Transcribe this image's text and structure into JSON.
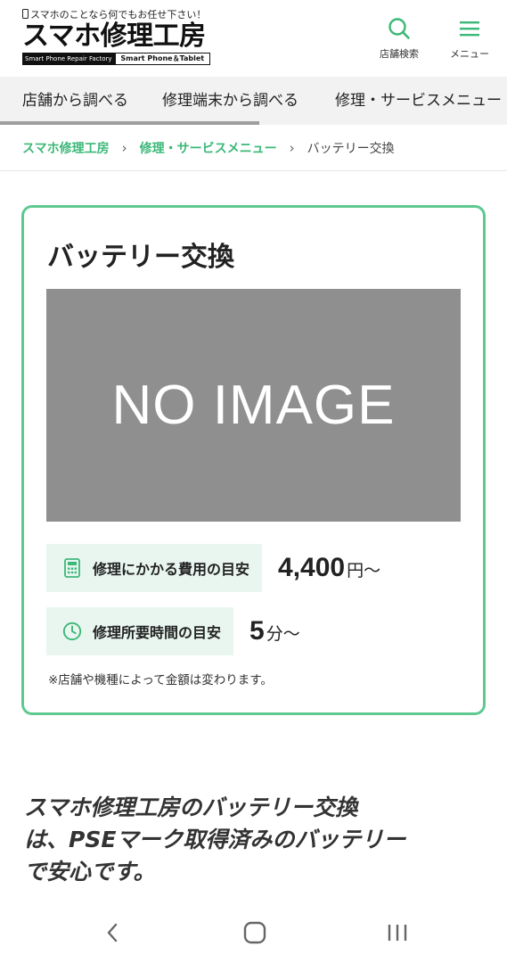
{
  "header": {
    "logo": {
      "tagline": "スマホのことなら何でもお任せ下さい！",
      "name": "スマホ修理工房",
      "bar_left": "Smart Phone Repair Factory",
      "bar_right": "Smart Phone＆Tablet"
    },
    "search_label": "店舗検索",
    "menu_label": "メニュー",
    "accent_color": "#3cb878"
  },
  "nav": {
    "items": [
      {
        "label": "店舗から調べる"
      },
      {
        "label": "修理端末から調べる"
      },
      {
        "label": "修理・サービスメニュー"
      }
    ]
  },
  "breadcrumb": {
    "home": "スマホ修理工房",
    "parent": "修理・サービスメニュー",
    "current": "バッテリー交換"
  },
  "card": {
    "title": "バッテリー交換",
    "image_text": "NO IMAGE",
    "cost": {
      "label": "修理にかかる費用の目安",
      "value": "4,400",
      "unit": "円〜",
      "icon": "calculator-icon"
    },
    "time": {
      "label": "修理所要時間の目安",
      "value": "5",
      "unit": "分〜",
      "icon": "clock-icon"
    },
    "note": "※店舗や機種によって金額は変わります。",
    "border_color": "#5ec98f"
  },
  "lead": {
    "line1": "スマホ修理工房のバッテリー交換",
    "line2": "は、PSEマーク取得済みのバッテリー",
    "line3": "で安心です。"
  },
  "system_nav": {
    "icons": [
      "back-icon",
      "home-icon",
      "recents-icon"
    ]
  }
}
